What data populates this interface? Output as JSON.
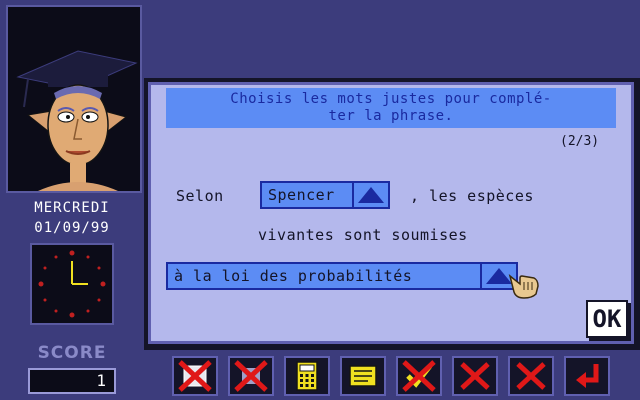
{
  "sidebar": {
    "day": "MERCREDI",
    "date": "01/09/99",
    "score_label": "SCORE",
    "score_value": "1"
  },
  "exercise": {
    "instruction_line1": "Choisis les mots justes pour complé-",
    "instruction_line2": "ter la phrase.",
    "progress": "(2/3)",
    "text_before": "Selon",
    "choice1": "Spencer",
    "text_middle": ", les espèces",
    "text_line2": "vivantes sont soumises",
    "choice2": "à la loi des probabilités",
    "ok_label": "OK"
  },
  "toolbar": {
    "buttons": [
      "x-icon",
      "x-icon",
      "calculator-icon",
      "notes-icon",
      "check-x-icon",
      "x-icon",
      "x-icon",
      "return-icon"
    ]
  },
  "colors": {
    "panel_bg": "#b4b8ec",
    "select_bg": "#5c8cf4",
    "sidebar_bg": "#3c3c7c"
  }
}
